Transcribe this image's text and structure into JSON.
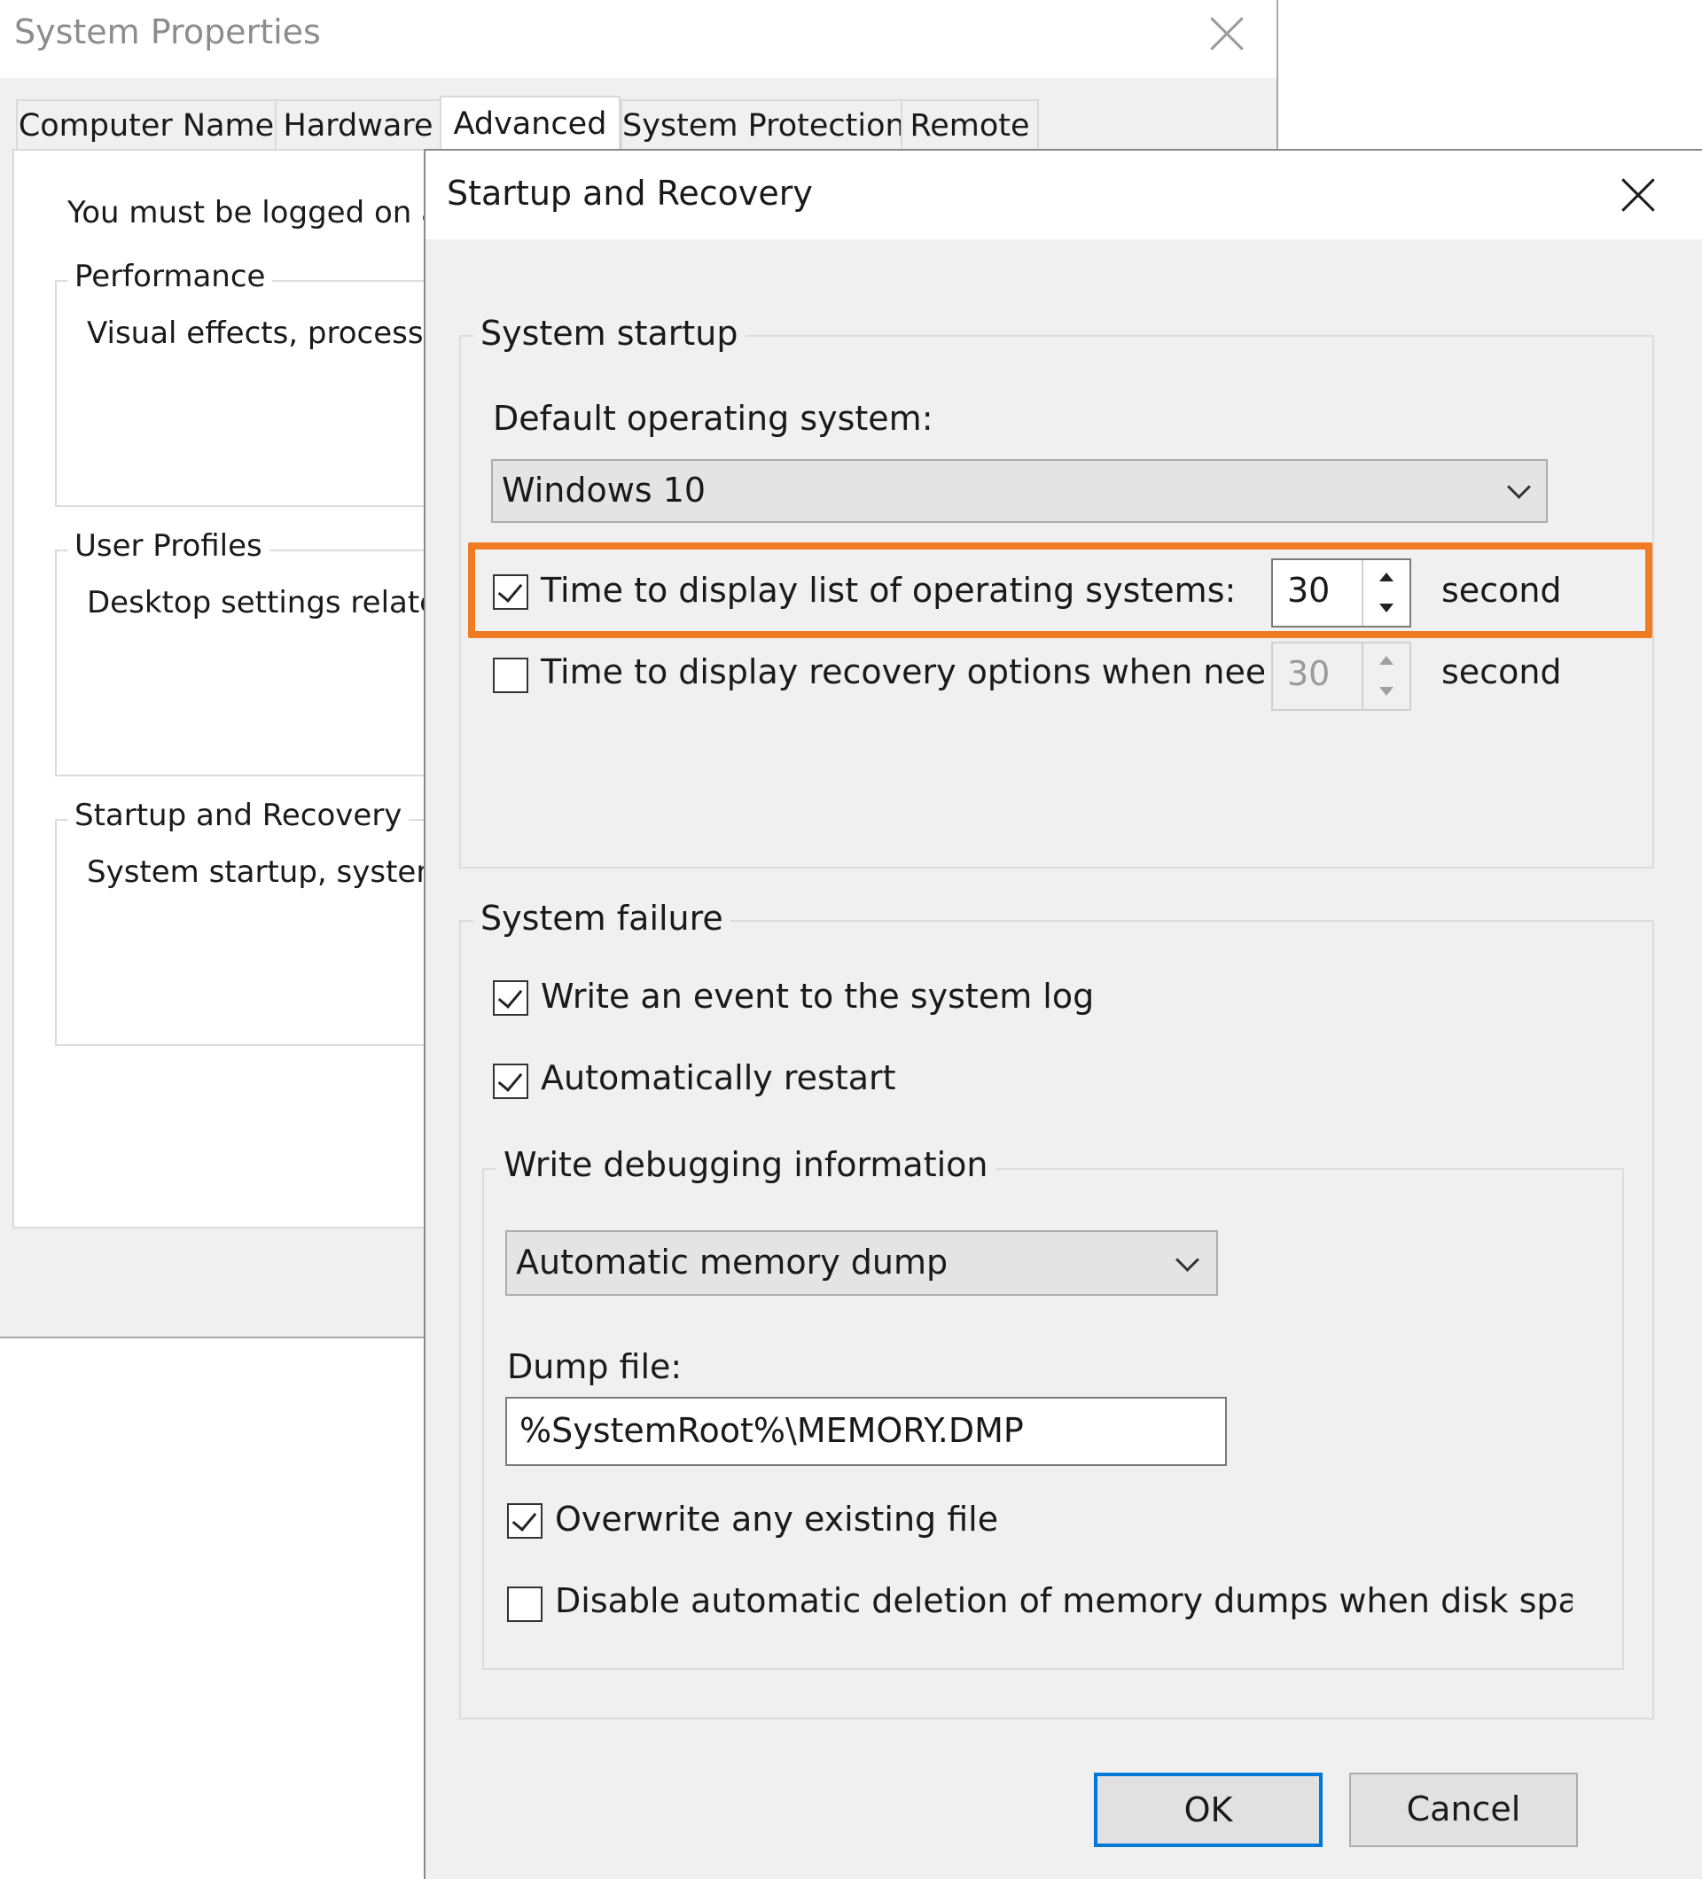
{
  "system_properties": {
    "title": "System Properties",
    "tabs": [
      "Computer Name",
      "Hardware",
      "Advanced",
      "System Protection",
      "Remote"
    ],
    "active_tab": "Advanced",
    "notice": "You must be logged on a",
    "groups": [
      {
        "legend": "Performance",
        "description": "Visual effects, processo"
      },
      {
        "legend": "User Profiles",
        "description": "Desktop settings related"
      },
      {
        "legend": "Startup and Recovery",
        "description": "System startup, system f"
      }
    ]
  },
  "dialog": {
    "title": "Startup and Recovery",
    "system_startup": {
      "legend": "System startup",
      "default_os_label": "Default operating system:",
      "default_os_value": "Windows 10",
      "display_list": {
        "label": "Time to display list of operating systems:",
        "checked": true,
        "value": "30",
        "unit": "seconds"
      },
      "display_recovery": {
        "label": "Time to display recovery options when needed",
        "checked": false,
        "value": "30",
        "unit": "seconds"
      }
    },
    "system_failure": {
      "legend": "System failure",
      "write_event": {
        "label": "Write an event to the system log",
        "checked": true
      },
      "auto_restart": {
        "label": "Automatically restart",
        "checked": true
      },
      "debug": {
        "legend": "Write debugging information",
        "dump_type": "Automatic memory dump",
        "dump_file_label": "Dump file:",
        "dump_file_value": "%SystemRoot%\\MEMORY.DMP",
        "overwrite": {
          "label": "Overwrite any existing file",
          "checked": true
        },
        "disable_auto_delete": {
          "label": "Disable automatic deletion of memory dumps when disk space is low",
          "checked": false
        }
      }
    },
    "buttons": {
      "ok": "OK",
      "cancel": "Cancel"
    }
  },
  "colors": {
    "highlight": "#f07b23",
    "default_button_border": "#0078d7"
  }
}
